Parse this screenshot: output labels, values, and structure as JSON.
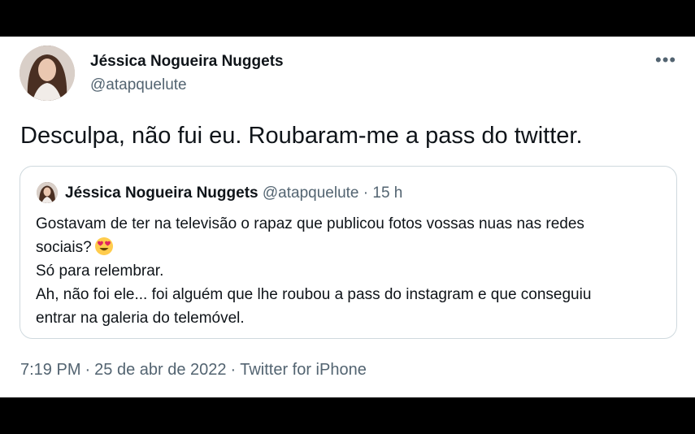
{
  "tweet": {
    "author_name": "Jéssica Nogueira Nuggets",
    "handle": "@atapquelute",
    "more_icon": "more-horizontal-icon",
    "text": "Desculpa, não fui eu. Roubaram-me a pass do twitter."
  },
  "quoted": {
    "author_name": "Jéssica Nogueira Nuggets",
    "handle": "@atapquelute",
    "separator": "·",
    "age": "15 h",
    "lines": [
      "Gostavam de ter na televisão o rapaz que publicou fotos vossas nuas nas redes",
      "sociais?",
      "Só para relembrar.",
      "Ah, não foi ele... foi alguém que lhe roubou a pass do instagram e que conseguiu",
      "entrar na galeria do telemóvel."
    ],
    "emoji": "heart-eyes-emoji"
  },
  "footer": {
    "time": "7:19 PM",
    "separator": "·",
    "date": "25 de abr de 2022",
    "source": "Twitter for iPhone"
  },
  "colors": {
    "text_primary": "#0f1419",
    "text_secondary": "#536471",
    "border": "#cfd9de",
    "background": "#ffffff"
  }
}
